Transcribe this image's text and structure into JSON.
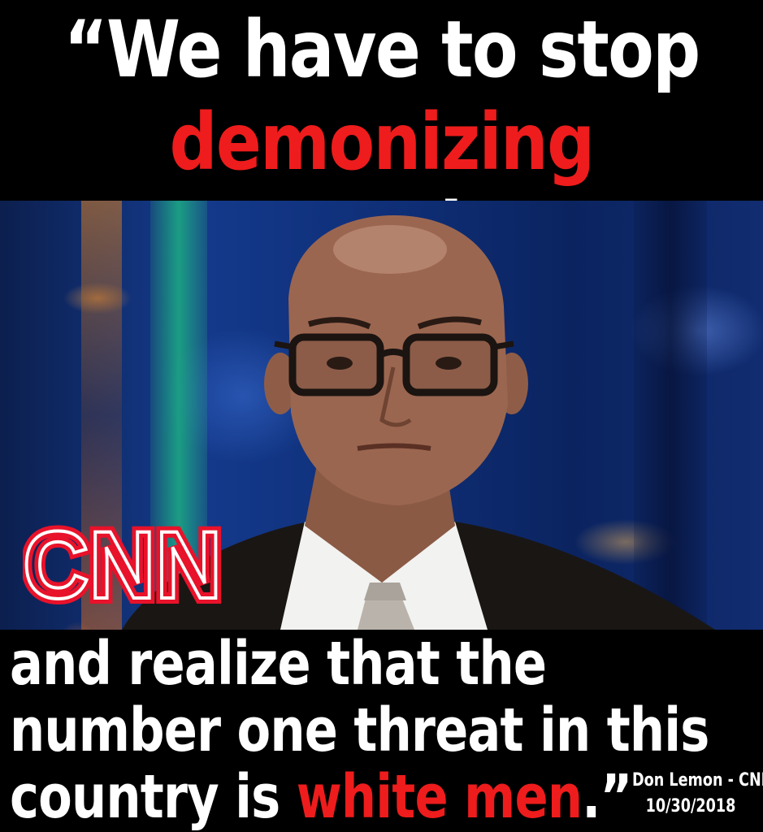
{
  "headline": {
    "line1": "“We have to stop",
    "line2_highlight": "demonizing",
    "line2_rest": " people"
  },
  "quote": {
    "line3": "and realize that the",
    "line4": "number one threat in this",
    "line5_start": "country is ",
    "line5_highlight": "white men",
    "line5_end": ".",
    "close_quote": "”"
  },
  "credit": {
    "name": "Don Lemon - CNN",
    "date": "10/30/2018"
  },
  "logo": {
    "text": "CNN",
    "color": "#e8122a"
  },
  "colors": {
    "background": "#000000",
    "text": "#ffffff",
    "highlight": "#ee1c1c"
  }
}
